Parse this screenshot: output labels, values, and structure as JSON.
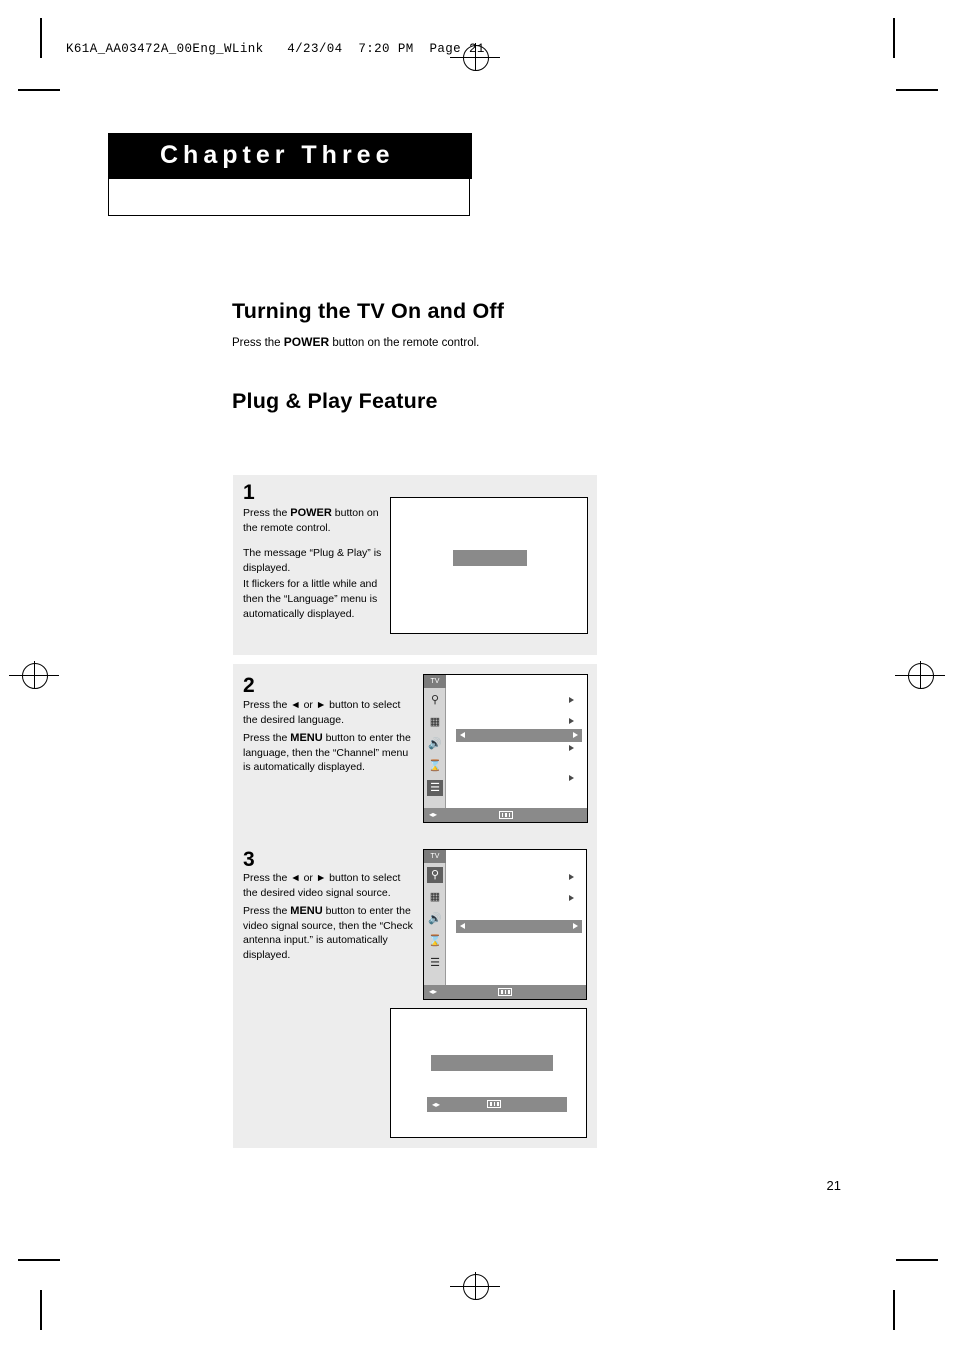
{
  "header": {
    "filename_line": "K61A_AA03472A_00Eng_WLink   4/23/04  7:20 PM  Page 21"
  },
  "chapter": {
    "title": "Chapter Three"
  },
  "sections": [
    {
      "heading": "Turning the TV On and Off",
      "body_prefix": "Press the ",
      "body_bold": "POWER",
      "body_suffix": " button on the remote control."
    },
    {
      "heading": "Plug & Play Feature"
    }
  ],
  "steps": [
    {
      "number": "1",
      "paragraphs": [
        {
          "pre": "Press the ",
          "bold": "POWER",
          "post": " button on the remote control."
        },
        {
          "pre": "The message “Plug & Play” is displayed.",
          "bold": "",
          "post": ""
        },
        {
          "pre": "It flickers for a little while and then the “Language” menu is automatically displayed.",
          "bold": "",
          "post": ""
        }
      ]
    },
    {
      "number": "2",
      "paragraphs": [
        {
          "pre": "Press the ◄ or ► button to select the desired language.",
          "bold": "",
          "post": ""
        },
        {
          "pre": "Press the ",
          "bold": "MENU",
          "post": " button to enter the language, then the “Channel” menu is automatically displayed."
        }
      ]
    },
    {
      "number": "3",
      "paragraphs": [
        {
          "pre": "Press the ◄ or ► button to select the desired video signal source.",
          "bold": "",
          "post": ""
        },
        {
          "pre": "Press the ",
          "bold": "MENU",
          "post": " button to enter the video signal source, then the “Check antenna input.” is automatically displayed."
        }
      ]
    }
  ],
  "tv_screens": {
    "screen1": {
      "name": "plug-play-message-screen",
      "content_label": ""
    },
    "screen2": {
      "name": "language-menu-screen",
      "title": "TV",
      "icons": [
        "antenna-icon",
        "picture-icon",
        "speaker-icon",
        "clock-icon",
        "settings-icon"
      ],
      "selected_icon_index": 4
    },
    "screen3": {
      "name": "video-signal-source-menu-screen",
      "title": "TV",
      "icons": [
        "antenna-icon",
        "picture-icon",
        "speaker-icon",
        "clock-icon",
        "settings-icon"
      ],
      "selected_icon_index": 0
    },
    "screen4": {
      "name": "check-antenna-input-screen",
      "content_label": ""
    }
  },
  "footer": {
    "page_number": "21"
  },
  "colors": {
    "chapter_bar": "#000000",
    "panel_bg": "#ededed",
    "menu_grey": "#8a8a8a",
    "icon_col": "#d5d5d5"
  }
}
